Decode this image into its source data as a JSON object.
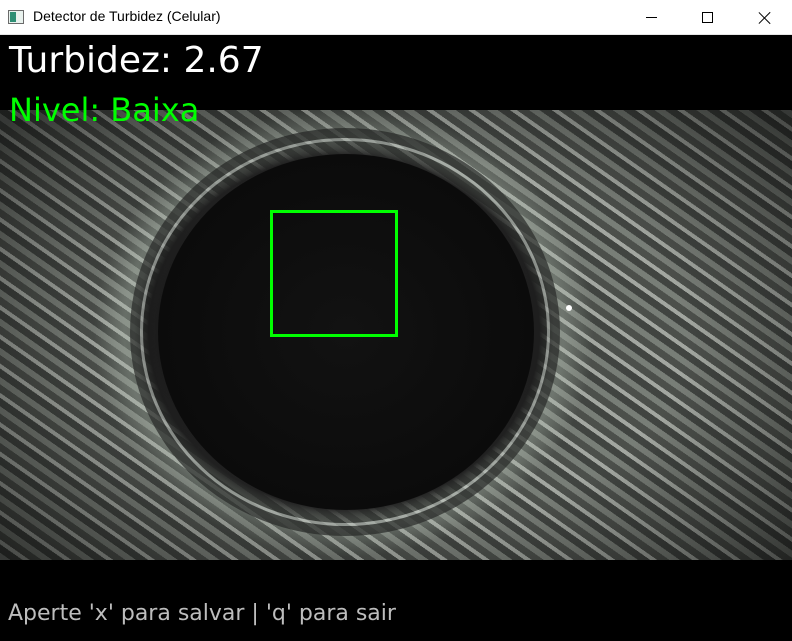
{
  "window": {
    "title": "Detector de Turbidez (Celular)",
    "icon": "app-window-icon",
    "controls": {
      "minimize_icon": "minimize-icon",
      "maximize_icon": "maximize-icon",
      "close_icon": "close-icon"
    }
  },
  "overlay": {
    "turbidity_label": "Turbidez: 2.67",
    "level_label": "Nivel: Baixa",
    "instructions": "Aperte 'x' para salvar | 'q' para sair"
  },
  "colors": {
    "turbidity_text": "#ffffff",
    "level_text": "#00ff00",
    "roi_box": "#00ff00",
    "instructions_text": "#bdbdbd",
    "background": "#000000"
  }
}
